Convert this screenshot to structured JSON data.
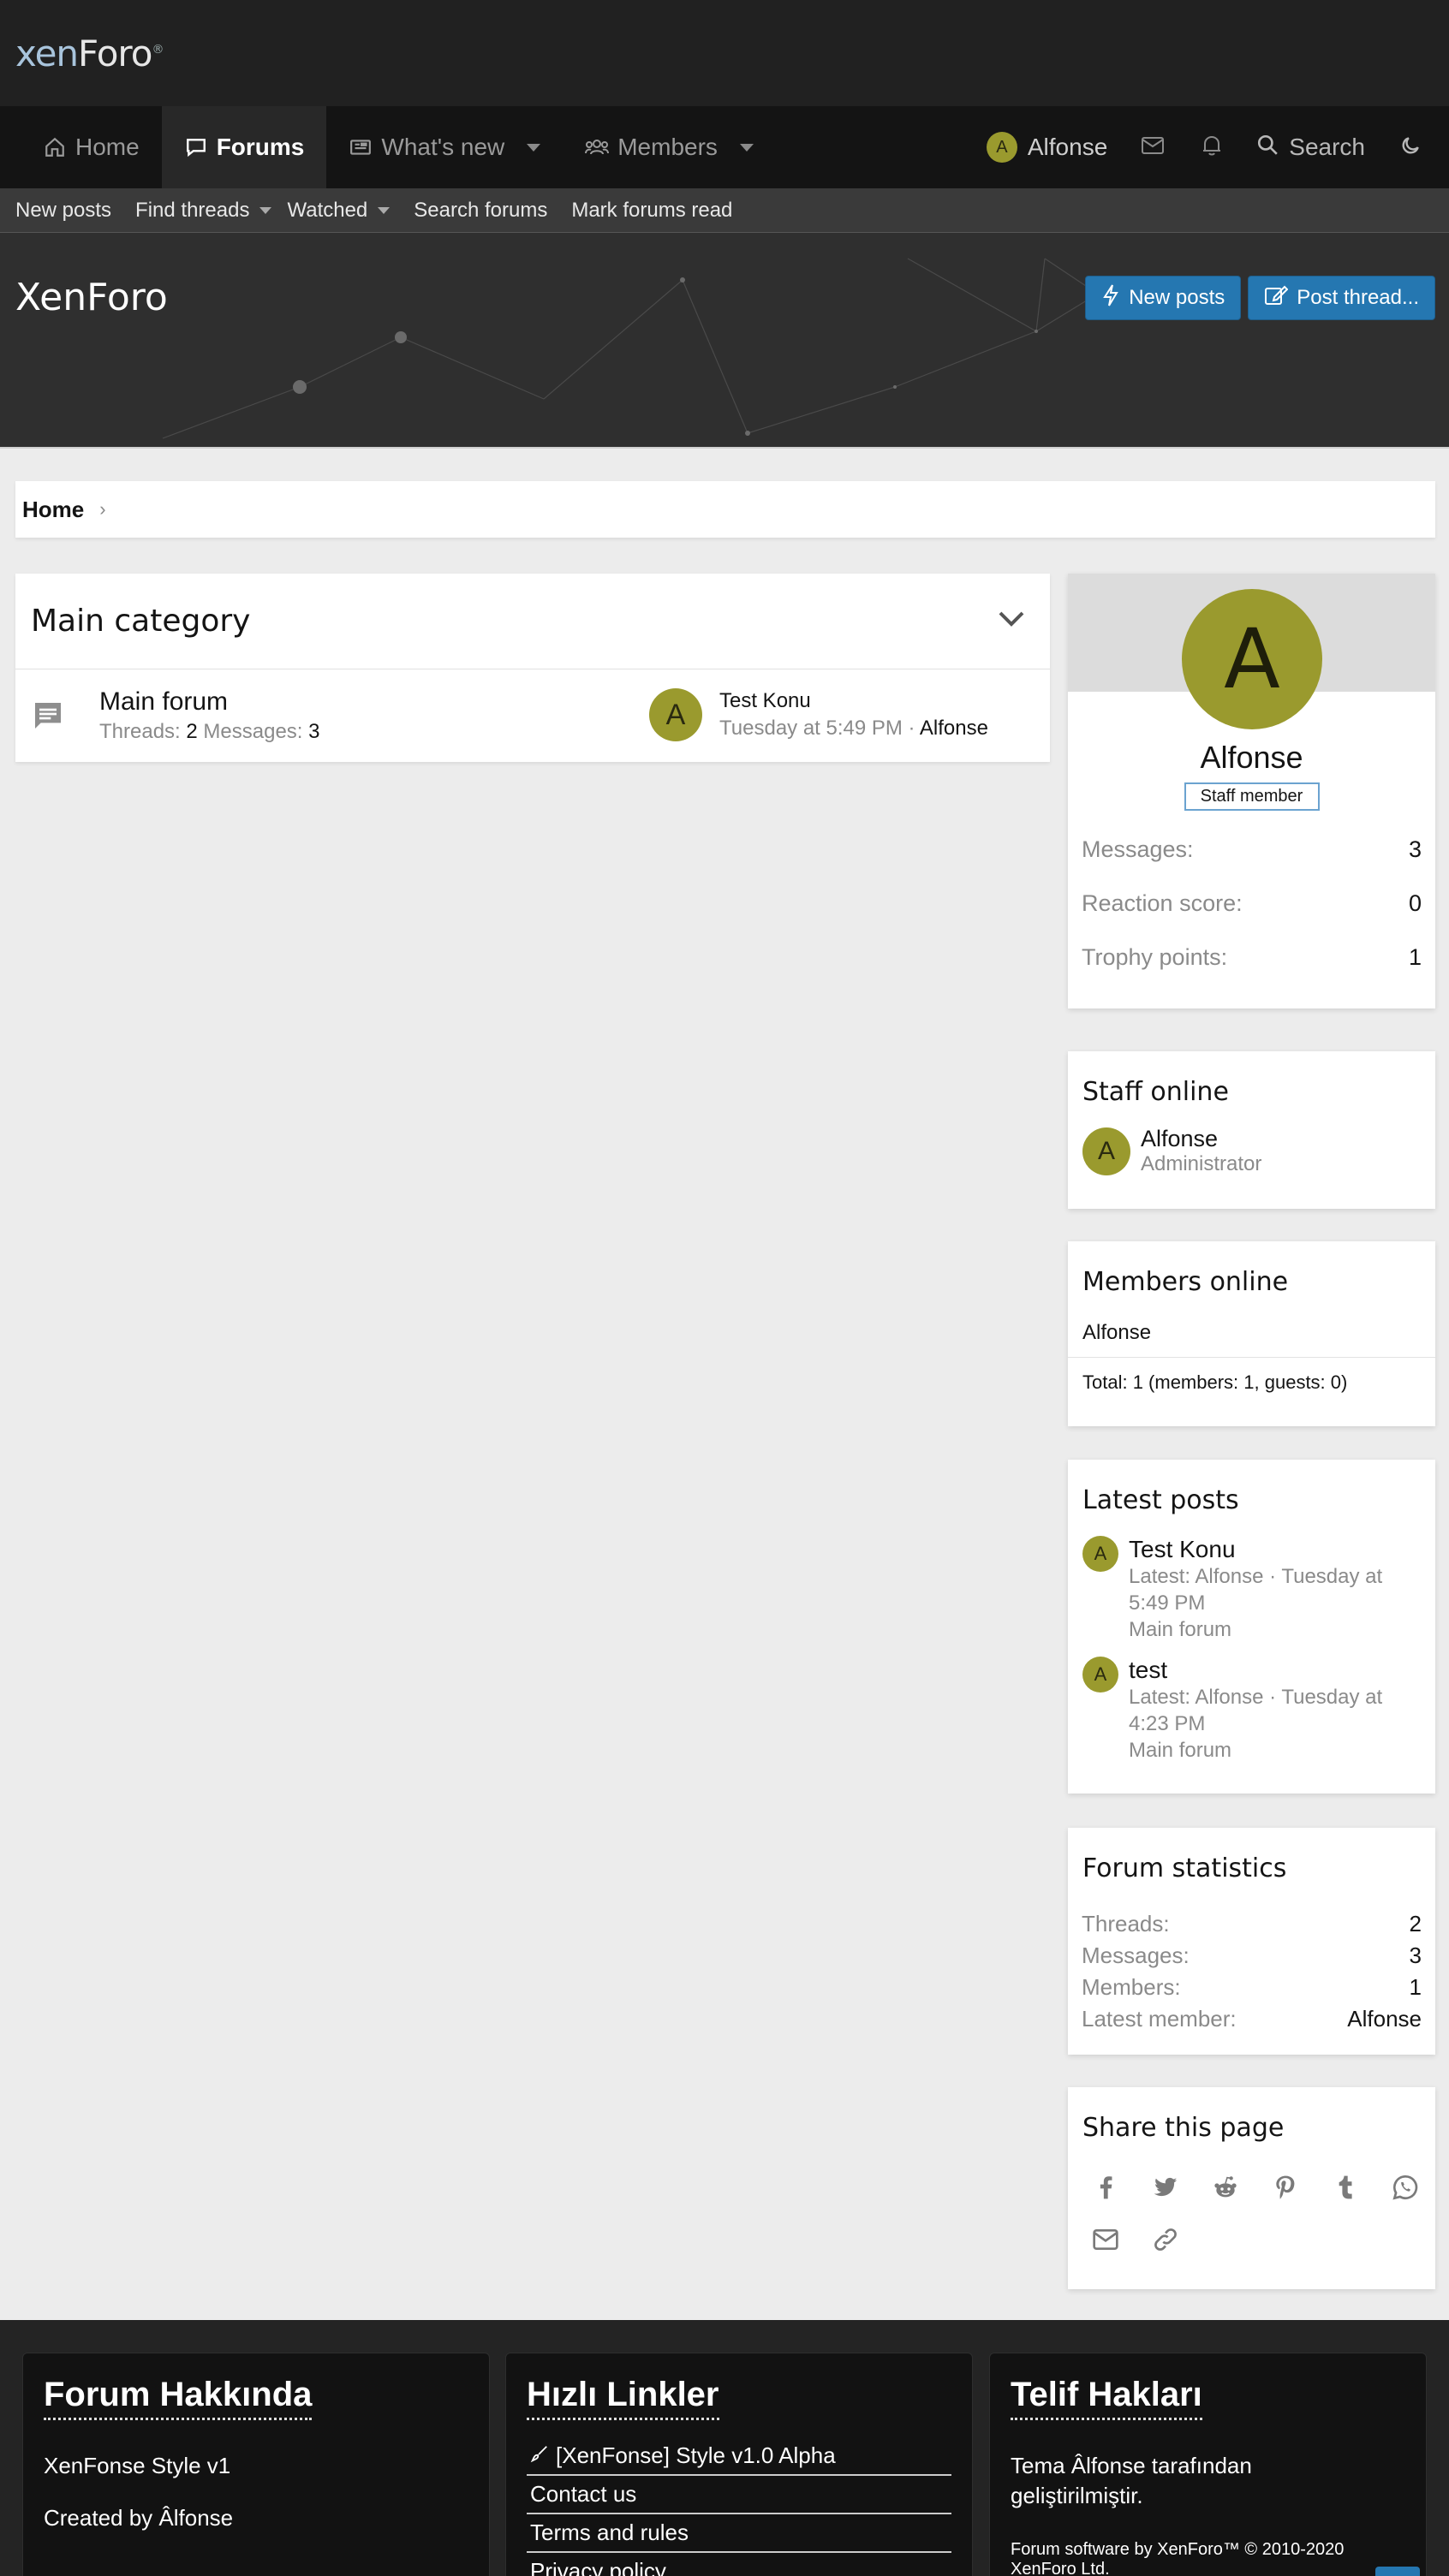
{
  "logo": {
    "part1": "xen",
    "part2": "Foro",
    "reg": "®"
  },
  "nav": {
    "tabs": [
      {
        "label": "Home",
        "icon": "home-icon"
      },
      {
        "label": "Forums",
        "icon": "forums-icon"
      },
      {
        "label": "What's new",
        "icon": "news-icon"
      },
      {
        "label": "Members",
        "icon": "members-icon"
      }
    ],
    "user": {
      "initial": "A",
      "name": "Alfonse"
    },
    "search_label": "Search"
  },
  "subnav": {
    "items": [
      "New posts",
      "Find threads",
      "Watched",
      "Search forums",
      "Mark forums read"
    ]
  },
  "hero": {
    "title": "XenForo",
    "new_posts_label": "New posts",
    "post_thread_label": "Post thread..."
  },
  "breadcrumb": {
    "home": "Home"
  },
  "category": {
    "title": "Main category",
    "forum": {
      "name": "Main forum",
      "threads_label": "Threads:",
      "threads": "2",
      "messages_label": "Messages:",
      "messages": "3",
      "last_post": {
        "initial": "A",
        "title": "Test Konu",
        "time": "Tuesday at 5:49 PM ·",
        "user": "Alfonse"
      }
    }
  },
  "profile": {
    "initial": "A",
    "name": "Alfonse",
    "badge": "Staff member",
    "stats": [
      {
        "label": "Messages:",
        "value": "3"
      },
      {
        "label": "Reaction score:",
        "value": "0"
      },
      {
        "label": "Trophy points:",
        "value": "1"
      }
    ]
  },
  "staff_online": {
    "title": "Staff online",
    "member": {
      "initial": "A",
      "name": "Alfonse",
      "role": "Administrator"
    }
  },
  "members_online": {
    "title": "Members online",
    "member": "Alfonse",
    "total": "Total: 1 (members: 1, guests: 0)"
  },
  "latest_posts": {
    "title": "Latest posts",
    "items": [
      {
        "initial": "A",
        "title": "Test Konu",
        "meta1": "Latest: Alfonse · Tuesday at",
        "meta2": "5:49 PM",
        "forum": "Main forum"
      },
      {
        "initial": "A",
        "title": "test",
        "meta1": "Latest: Alfonse · Tuesday at",
        "meta2": "4:23 PM",
        "forum": "Main forum"
      }
    ]
  },
  "forum_stats": {
    "title": "Forum statistics",
    "rows": [
      {
        "label": "Threads:",
        "value": "2"
      },
      {
        "label": "Messages:",
        "value": "3"
      },
      {
        "label": "Members:",
        "value": "1"
      },
      {
        "label": "Latest member:",
        "value": "Alfonse"
      }
    ]
  },
  "share": {
    "title": "Share this page",
    "icons": [
      "facebook-icon",
      "twitter-icon",
      "reddit-icon",
      "pinterest-icon",
      "tumblr-icon",
      "whatsapp-icon",
      "email-icon",
      "link-icon"
    ]
  },
  "footer": {
    "about": {
      "title": "Forum Hakkında",
      "line1": "XenFonse Style v1",
      "line2": "Created by Âlfonse"
    },
    "links": {
      "title": "Hızlı Linkler",
      "items": [
        "[XenFonse] Style v1.0 Alpha",
        "Contact us",
        "Terms and rules",
        "Privacy policy"
      ]
    },
    "copyright": {
      "title": "Telif Hakları",
      "line1": "Tema Âlfonse tarafından",
      "line2": "geliştirilmiştir.",
      "software": "Forum software by XenForo™ © 2010-2020",
      "software2": "XenForo Ltd."
    }
  },
  "colors": {
    "accent": "#2577b1",
    "avatar": "#9a9a2e",
    "header": "#212121",
    "nav": "#141414"
  }
}
